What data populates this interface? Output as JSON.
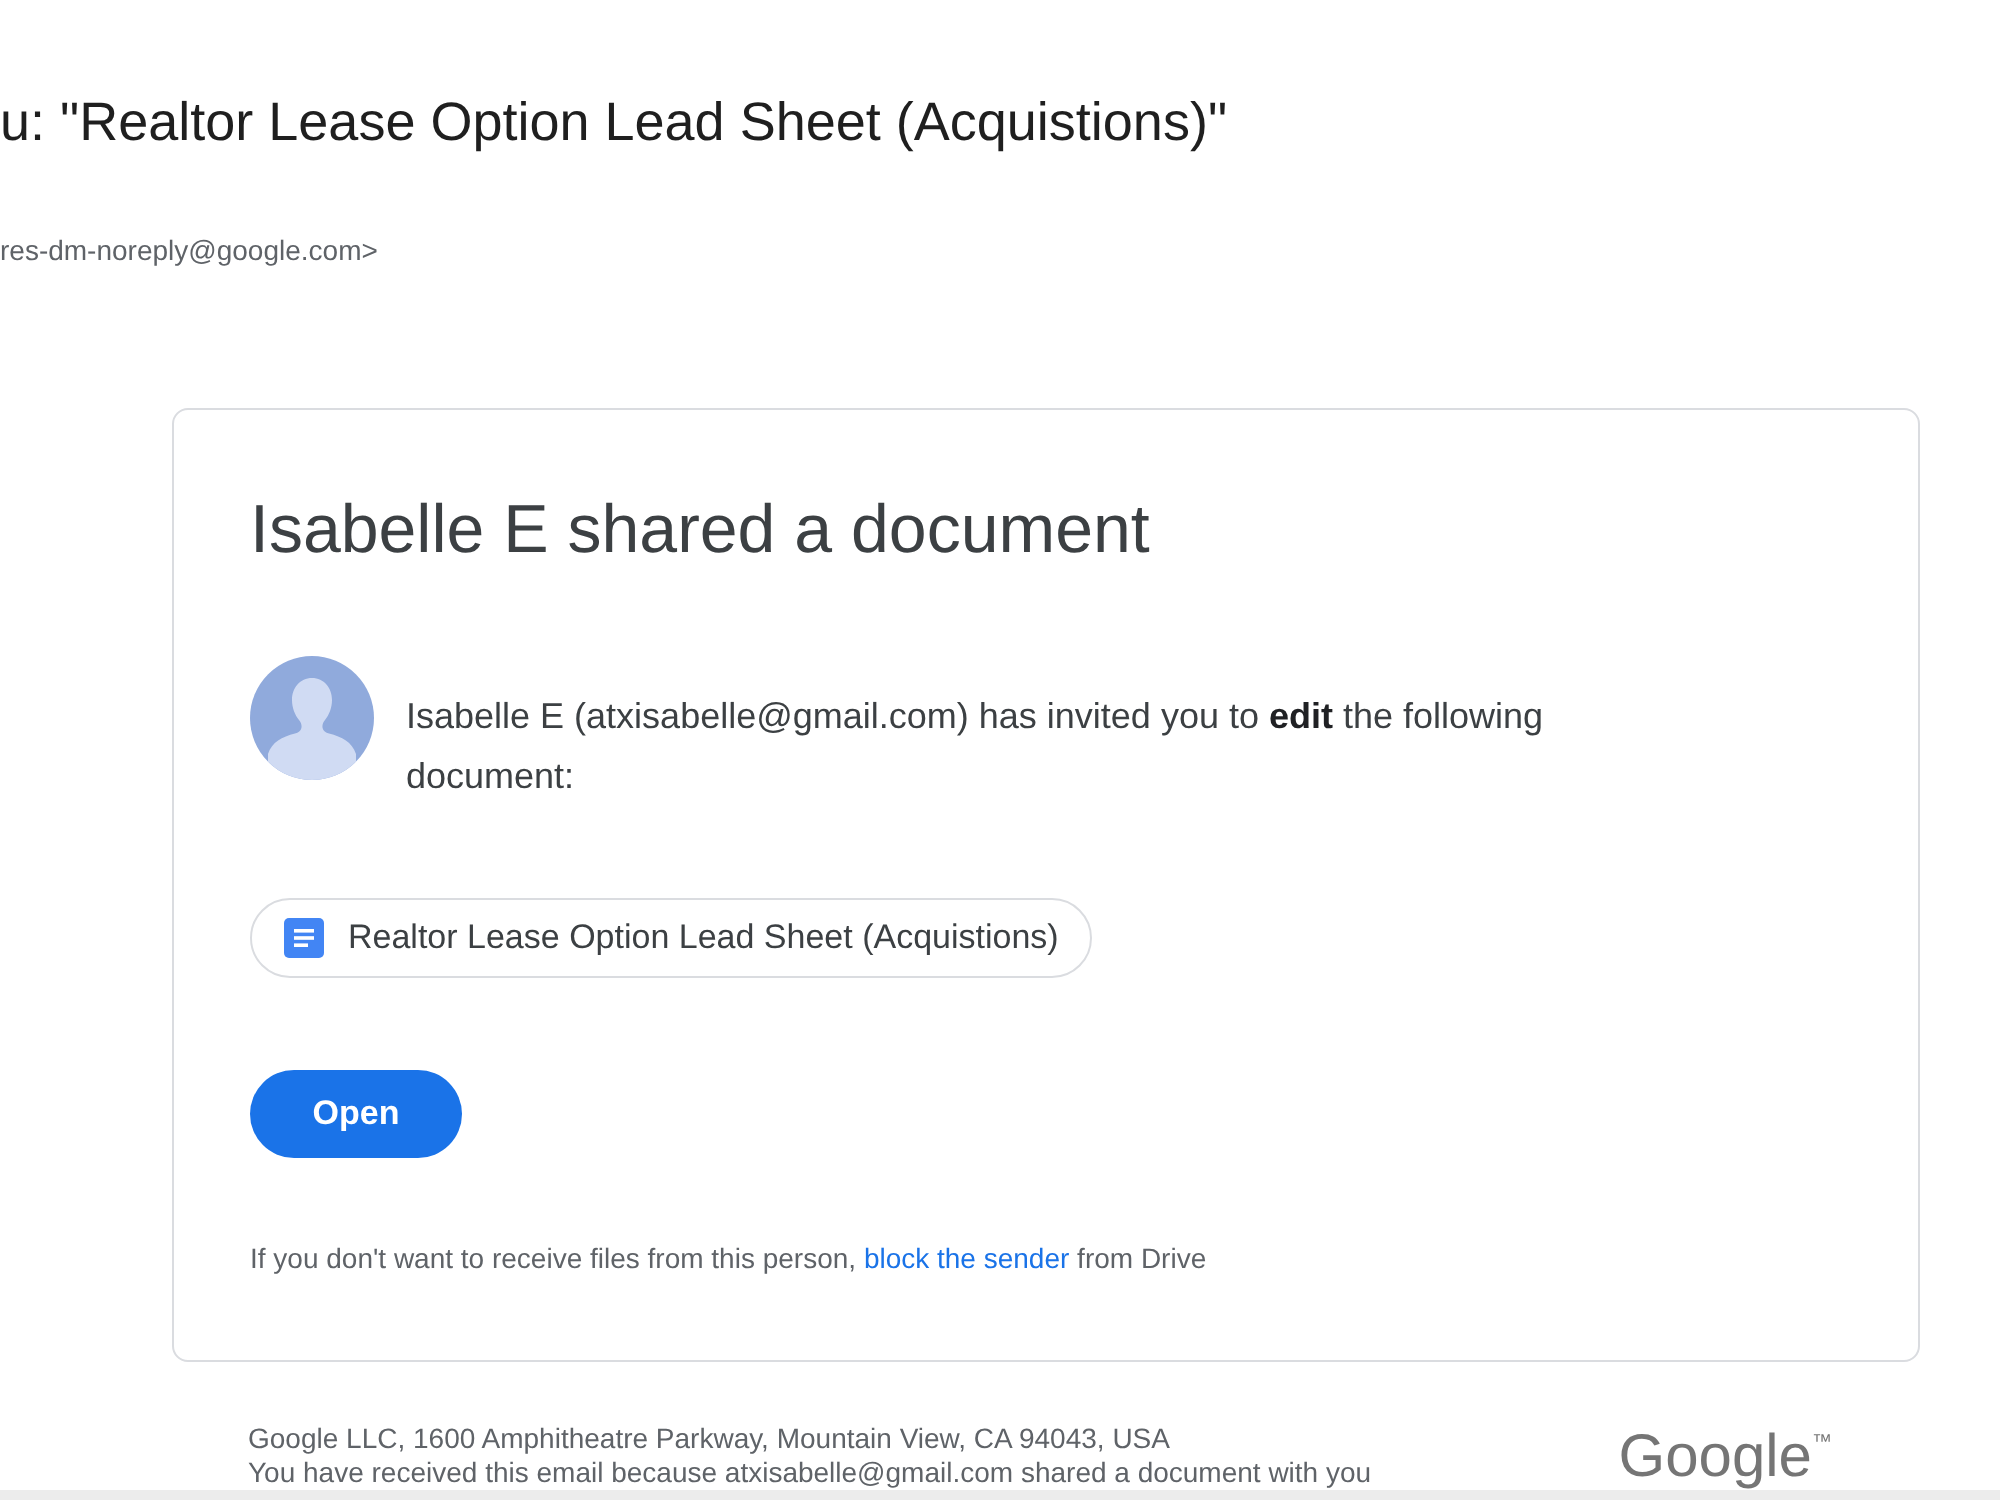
{
  "email": {
    "subject": "u: \"Realtor Lease Option Lead Sheet (Acquistions)\"",
    "sender": "res-dm-noreply@google.com>"
  },
  "card": {
    "title": "Isabelle E shared a document",
    "message": "Isabelle E (atxisabelle@gmail.com) has invited you to **edit** the following document:",
    "file": {
      "name": "Realtor Lease Option Lead Sheet (Acquistions)"
    },
    "button": "Open",
    "notice": {
      "before": "If you don't want to receive files from this person,",
      "link": "block the sender",
      "after": "from Drive"
    }
  },
  "footer": {
    "address": "Google LLC, 1600 Amphitheatre Parkway, Mountain View, CA 94043, USA",
    "reason": "You have received this email because atxisabelle@gmail.com shared a document with you",
    "logo": "Google$^{™}$"
  }
}
